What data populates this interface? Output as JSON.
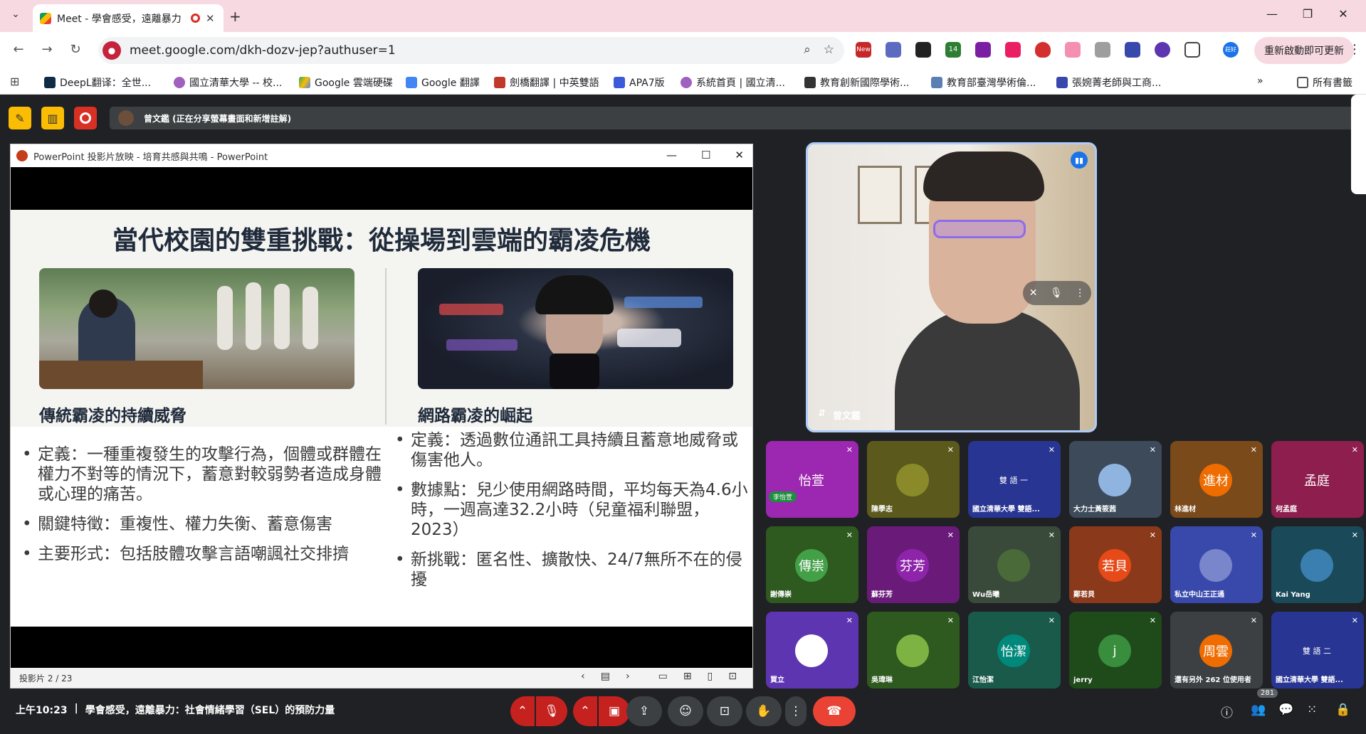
{
  "browser": {
    "tab_title": "Meet - 學會感受，遠離暴力",
    "url": "meet.google.com/dkh-dozv-jep?authuser=1",
    "restart_label": "重新啟動即可更新",
    "ext_new_label": "New",
    "ext_count_label": "14",
    "profile_label": "莊好"
  },
  "bookmarks": [
    {
      "label": "DeepL翻译：全世...",
      "color": "#0f2b46"
    },
    {
      "label": "國立清華大學 -- 校...",
      "color": "#a060c0"
    },
    {
      "label": "Google 雲端硬碟",
      "color": "#34a853"
    },
    {
      "label": "Google 翻譯",
      "color": "#4285f4"
    },
    {
      "label": "劍橋翻譯 | 中英雙語",
      "color": "#c0392b"
    },
    {
      "label": "APA7版",
      "color": "#3b5bdb"
    },
    {
      "label": "系統首頁 | 國立清...",
      "color": "#a060c0"
    },
    {
      "label": "教育創新國際學術...",
      "color": "#333333"
    },
    {
      "label": "教育部臺灣學術倫...",
      "color": "#5b7fb3"
    },
    {
      "label": "張婉菁老師與工商...",
      "color": "#3949ab"
    },
    {
      "label": "所有書籤",
      "color": "#555555"
    }
  ],
  "meet": {
    "share_banner": "曾文鑑 (正在分享螢幕畫面和新增註解)",
    "ppt": {
      "window_title": "PowerPoint 投影片放映 - 培育共感與共鳴 - PowerPoint",
      "slide_title": "當代校園的雙重挑戰：從操場到雲端的霸凌危機",
      "left_heading": "傳統霸凌的持續威脅",
      "right_heading": "網路霸凌的崛起",
      "left_bullets": [
        "定義：一種重複發生的攻擊行為，個體或群體在權力不對等的情況下，蓄意對較弱勢者造成身體或心理的痛苦。",
        "關鍵特徵：重複性、權力失衡、蓄意傷害",
        "主要形式：包括肢體攻擊言語嘲諷社交排擠"
      ],
      "right_bullets": [
        "定義：透過數位通訊工具持續且蓄意地威脅或傷害他人。",
        "數據點：兒少使用網路時間，平均每天為4.6小時，一週高達32.2小時（兒童福利聯盟，2023）",
        "新挑戰：匿名性、擴散快、24/7無所不在的侵擾"
      ],
      "slide_counter": "投影片 2 / 23"
    },
    "speaker_name": "曾文鑑",
    "participants": [
      {
        "name": "",
        "avatar": "怡萱",
        "bg": "#9c27b0",
        "avatar_bg": "#9c27b0",
        "badge": "李怡萱"
      },
      {
        "name": "陳學志",
        "avatar": "",
        "bg": "#5b5a1c",
        "avatar_bg": "#8a8a2a"
      },
      {
        "name": "國立清華大學 雙語...",
        "avatar": "雙 語 一",
        "bg": "#283593",
        "avatar_bg": "#283593"
      },
      {
        "name": "大力士黃筱茜",
        "avatar": "",
        "bg": "#3c4a5a",
        "avatar_bg": "#8fb4e0"
      },
      {
        "name": "林進材",
        "avatar": "進材",
        "bg": "#7a4a1a",
        "avatar_bg": "#ef6c00"
      },
      {
        "name": "何孟庭",
        "avatar": "孟庭",
        "bg": "#8e1e4e",
        "avatar_bg": "#8e1e4e"
      },
      {
        "name": "謝傳崇",
        "avatar": "傳崇",
        "bg": "#2e5a1f",
        "avatar_bg": "#43a047"
      },
      {
        "name": "蘇芬芳",
        "avatar": "芬芳",
        "bg": "#6a1b7a",
        "avatar_bg": "#8e24aa"
      },
      {
        "name": "Wu岳曦",
        "avatar": "",
        "bg": "#3a4a3a",
        "avatar_bg": "#4a6a3a"
      },
      {
        "name": "鄭若貝",
        "avatar": "若貝",
        "bg": "#8a3a1a",
        "avatar_bg": "#e64a19"
      },
      {
        "name": "私立中山王正通",
        "avatar": "",
        "bg": "#3949ab",
        "avatar_bg": "#7986cb"
      },
      {
        "name": "Kai Yang",
        "avatar": "",
        "bg": "#1a4a5a",
        "avatar_bg": "#3a7fb0"
      },
      {
        "name": "買立",
        "avatar": "",
        "bg": "#5e35b1",
        "avatar_bg": "#ffffff"
      },
      {
        "name": "吳瑋琳",
        "avatar": "",
        "bg": "#2e5a1f",
        "avatar_bg": "#7cb342"
      },
      {
        "name": "江怡潔",
        "avatar": "怡潔",
        "bg": "#1a5a4a",
        "avatar_bg": "#00897b"
      },
      {
        "name": "jerry",
        "avatar": "j",
        "bg": "#1f4a1a",
        "avatar_bg": "#388e3c"
      },
      {
        "name": "還有另外 262 位使用者",
        "avatar": "周雲",
        "bg": "#3c4043",
        "avatar_bg": "#ef6c00"
      },
      {
        "name": "國立清華大學 雙語...",
        "avatar": "雙 語 二",
        "bg": "#283593",
        "avatar_bg": "#283593"
      }
    ],
    "time": "上午10:23",
    "meeting_title": "學會感受，遠離暴力：社會情緒學習（SEL）的預防力量",
    "people_count": "281"
  },
  "colors": {
    "accent_red": "#c5221f",
    "end_call": "#ea4335",
    "meet_bg": "#202124"
  }
}
